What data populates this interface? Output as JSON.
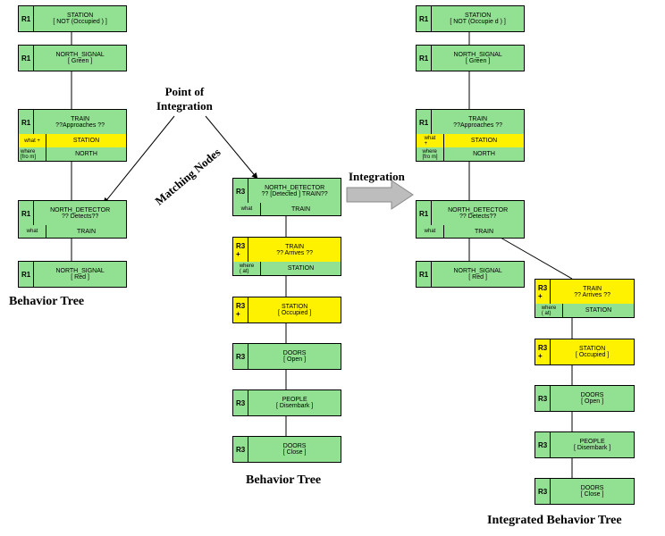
{
  "titles": {
    "left": "Behavior Tree",
    "mid": "Behavior Tree",
    "right": "Integrated Behavior Tree"
  },
  "labels": {
    "point": "Point of\nIntegration",
    "match": "Matching Nodes",
    "integ": "Integration"
  },
  "L": {
    "n1": {
      "t": "R1",
      "a": "STATION",
      "b": "[ NOT (Occupied ) ]"
    },
    "n2": {
      "t": "R1",
      "a": "NORTH_SIGNAL",
      "b": "[ Green ]"
    },
    "n3": {
      "t": "R1",
      "a": "TRAIN",
      "b": "??Approaches ??"
    },
    "s3a": {
      "l": "what\n+",
      "v": "STATION"
    },
    "s3b": {
      "l": "where\n[fro m]",
      "v": "NORTH"
    },
    "n4": {
      "t": "R1",
      "a": "NORTH_DETECTOR",
      "b": "?? Detects??"
    },
    "s4": {
      "l": "what",
      "v": "TRAIN"
    },
    "n5": {
      "t": "R1",
      "a": "NORTH_SIGNAL",
      "b": "[ Red ]"
    }
  },
  "M": {
    "n1": {
      "t": "R3",
      "a": "NORTH_DETECTOR",
      "b": "?? [Detected ] TRAIN??"
    },
    "s1": {
      "l": "what",
      "v": "TRAIN"
    },
    "n2": {
      "t": "R3\n+",
      "a": "TRAIN",
      "b": "?? Arrives ??"
    },
    "s2": {
      "l": "where\n( at)",
      "v": "STATION"
    },
    "n3": {
      "t": "R3\n+",
      "a": "STATION",
      "b": "[ Occupied ]"
    },
    "n4": {
      "t": "R3",
      "a": "DOORS",
      "b": "[ Open ]"
    },
    "n5": {
      "t": "R3",
      "a": "PEOPLE",
      "b": "[ Disembark ]"
    },
    "n6": {
      "t": "R3",
      "a": "DOORS",
      "b": "[ Close ]"
    }
  },
  "R": {
    "n1": {
      "t": "R1",
      "a": "STATION",
      "b": "[ NOT (Occupie d ) ]"
    },
    "n2": {
      "t": "R1",
      "a": "NORTH_SIGNAL",
      "b": "[ Green ]"
    },
    "n3": {
      "t": "R1",
      "a": "TRAIN",
      "b": "??Approaches ??"
    },
    "s3a": {
      "l": "what\n+",
      "v": "STATION"
    },
    "s3b": {
      "l": "where\n[fro m]",
      "v": "NORTH"
    },
    "n4": {
      "t": "R1",
      "a": "NORTH_DETECTOR",
      "b": "?? Detects??"
    },
    "s4": {
      "l": "what",
      "v": "TRAIN"
    },
    "n5": {
      "t": "R1",
      "a": "NORTH_SIGNAL",
      "b": "[ Red ]"
    },
    "b2": {
      "t": "R3\n+",
      "a": "TRAIN",
      "b": "?? Arrives ??"
    },
    "bs2": {
      "l": "where\n( at)",
      "v": "STATION"
    },
    "b3": {
      "t": "R3\n+",
      "a": "STATION",
      "b": "[ Occupied ]"
    },
    "b4": {
      "t": "R3",
      "a": "DOORS",
      "b": "[ Open ]"
    },
    "b5": {
      "t": "R3",
      "a": "PEOPLE",
      "b": "[ Disembark ]"
    },
    "b6": {
      "t": "R3",
      "a": "DOORS",
      "b": "[ Close ]"
    }
  }
}
